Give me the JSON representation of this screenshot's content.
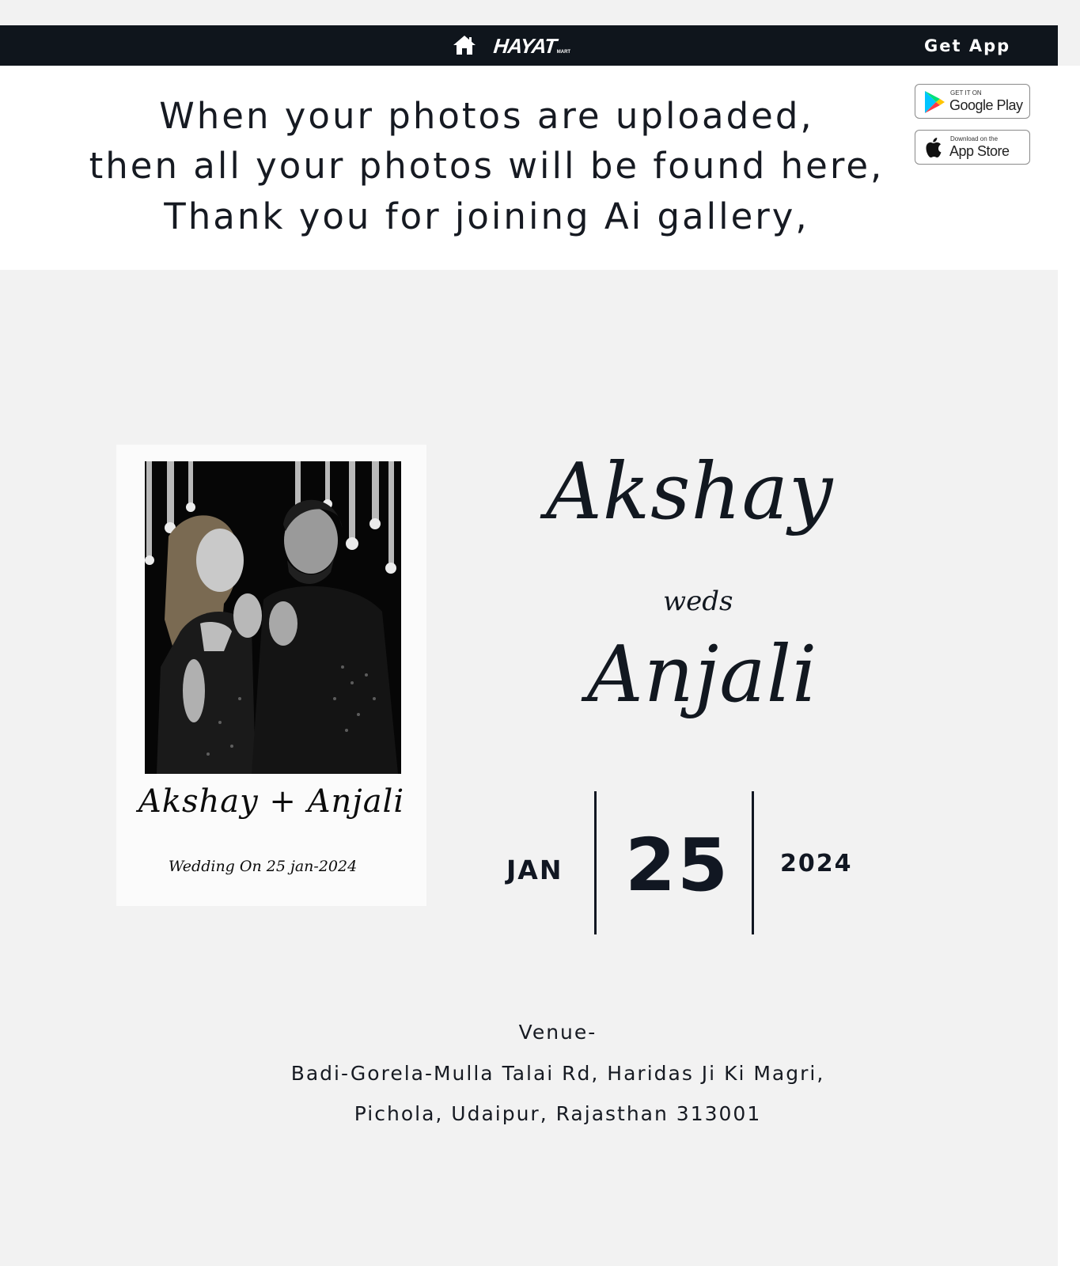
{
  "header": {
    "home_icon": "home-icon",
    "brand_name": "HAYAT",
    "brand_suffix": "MART",
    "get_app_label": "Get App",
    "background_color": "#0f151c"
  },
  "notice": {
    "lines": [
      "When your photos are uploaded,",
      "then all your photos will be found here,",
      "Thank you for joining Ai gallery,"
    ]
  },
  "store_badges": [
    {
      "icon": "google-play-icon",
      "small_text": "GET IT ON",
      "big_text": "Google Play"
    },
    {
      "icon": "apple-icon",
      "small_text": "Download on the",
      "big_text": "App Store"
    }
  ],
  "invitation": {
    "polaroid": {
      "photo": "couple-photo",
      "names": "Akshay + Anjali",
      "date_text": "Wedding On 25 jan-2024"
    },
    "groom": "Akshay",
    "weds": "weds",
    "bride": "Anjali",
    "date": {
      "month": "JAN",
      "day": "25",
      "year": "2024"
    },
    "venue": {
      "label": "Venue-",
      "line1": "Badi-Gorela-Mulla Talai Rd, Haridas Ji Ki Magri,",
      "line2": "Pichola, Udaipur, Rajasthan 313001"
    }
  }
}
